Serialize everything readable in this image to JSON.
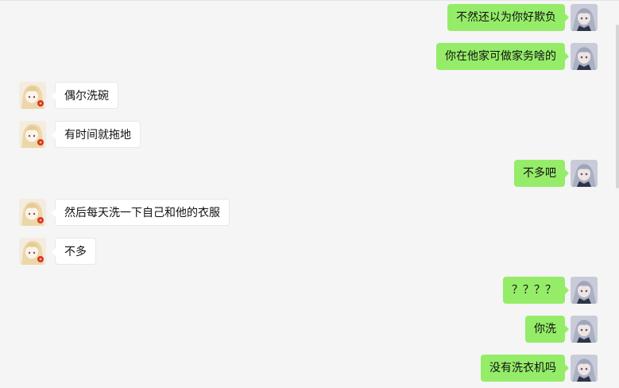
{
  "chat": {
    "messages": [
      {
        "side": "out",
        "text": "不然还以为你好欺负"
      },
      {
        "side": "out",
        "text": "你在他家可做家务啥的"
      },
      {
        "side": "in",
        "text": "偶尔洗碗"
      },
      {
        "side": "in",
        "text": "有时间就拖地"
      },
      {
        "side": "out",
        "text": "不多吧"
      },
      {
        "side": "in",
        "text": "然后每天洗一下自己和他的衣服"
      },
      {
        "side": "in",
        "text": "不多"
      },
      {
        "side": "out",
        "text": "？？？？"
      },
      {
        "side": "out",
        "text": "你洗"
      },
      {
        "side": "out",
        "text": "没有洗衣机吗"
      }
    ]
  },
  "colors": {
    "background": "#f5f5f5",
    "outgoing_bubble": "#95ec69",
    "incoming_bubble": "#ffffff",
    "text": "#111111"
  },
  "icons": {
    "outgoing_avatar": "anime-girl-silver-hair-avatar",
    "incoming_avatar": "anime-girl-blonde-avatar"
  }
}
